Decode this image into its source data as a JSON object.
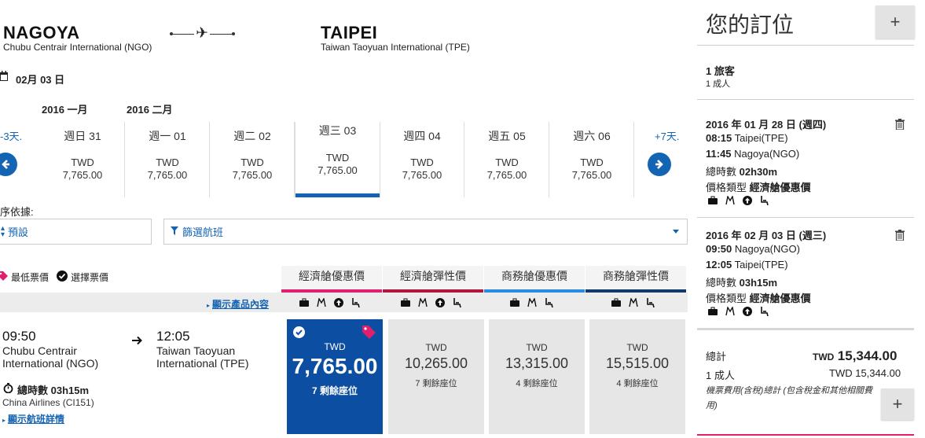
{
  "route": {
    "origin_city": "NAGOYA",
    "origin_airport": "Chubu Centrair International (NGO)",
    "dest_city": "TAIPEI",
    "dest_airport": "Taiwan Taoyuan International (TPE)",
    "plane_glyph": "✈"
  },
  "selected_date": "02月 03 日",
  "months": [
    "2016 一月",
    "2016 二月"
  ],
  "date_strip": {
    "prev_label": "-3天.",
    "next_label": "+7天.",
    "days": [
      {
        "day": "週日 31",
        "currency": "TWD",
        "amount": "7,765.00",
        "active": false
      },
      {
        "day": "週一 01",
        "currency": "TWD",
        "amount": "7,765.00",
        "active": false
      },
      {
        "day": "週二 02",
        "currency": "TWD",
        "amount": "7,765.00",
        "active": false
      },
      {
        "day": "週三 03",
        "currency": "TWD",
        "amount": "7,765.00",
        "active": true
      },
      {
        "day": "週四 04",
        "currency": "TWD",
        "amount": "7,765.00",
        "active": false
      },
      {
        "day": "週五 05",
        "currency": "TWD",
        "amount": "7,765.00",
        "active": false
      },
      {
        "day": "週六 06",
        "currency": "TWD",
        "amount": "7,765.00",
        "active": false
      }
    ]
  },
  "sort": {
    "label": "序依據:",
    "default_value": "預設",
    "filter_value": "篩選航班"
  },
  "legend": {
    "lowest": "最低票價",
    "selected": "選擇票價"
  },
  "show_products": "顯示產品內容",
  "fare_classes": [
    {
      "name": "經濟艙優惠價",
      "color": "#e0206e"
    },
    {
      "name": "經濟艙彈性價",
      "color": "#b0163e"
    },
    {
      "name": "商務艙優惠價",
      "color": "#2a8be0"
    },
    {
      "name": "商務艙彈性價",
      "color": "#103a6e"
    }
  ],
  "flight": {
    "dep_time": "09:50",
    "dep_place_1": "Chubu Centrair",
    "dep_place_2": "International (NGO)",
    "arr_time": "12:05",
    "arr_place_1": "Taiwan Taoyuan",
    "arr_place_2": "International (TPE)",
    "duration": "總時數 03h15m",
    "airline": "China Airlines (CI151)",
    "details_link": "顯示航班詳情",
    "fares": [
      {
        "currency": "TWD",
        "amount": "7,765.00",
        "seats": "7 剩餘座位",
        "selected": true
      },
      {
        "currency": "TWD",
        "amount": "10,265.00",
        "seats": "7 剩餘座位",
        "selected": false
      },
      {
        "currency": "TWD",
        "amount": "13,315.00",
        "seats": "4 剩餘座位",
        "selected": false
      },
      {
        "currency": "TWD",
        "amount": "15,515.00",
        "seats": "4 剩餘座位",
        "selected": false
      }
    ]
  },
  "booking": {
    "title": "您的訂位",
    "plus": "+",
    "travelers_title": "1 旅客",
    "travelers_detail": "1 成人",
    "segments": [
      {
        "date": "2016 年 01 月 28 日 (週四)",
        "dep_time": "08:15",
        "dep_place": "Taipei(TPE)",
        "arr_time": "11:45",
        "arr_place": "Nagoya(NGO)",
        "duration_label": "總時數",
        "duration": "02h30m",
        "fare_type_label": "價格類型",
        "fare_type": "經濟艙優惠價"
      },
      {
        "date": "2016 年 02 月 03 日 (週三)",
        "dep_time": "09:50",
        "dep_place": "Nagoya(NGO)",
        "arr_time": "12:05",
        "arr_place": "Taipei(TPE)",
        "duration_label": "總時數",
        "duration": "03h15m",
        "fare_type_label": "價格類型",
        "fare_type": "經濟艙優惠價"
      }
    ],
    "total_label": "總計",
    "total_currency": "TWD",
    "total_amount": "15,344.00",
    "adult_label": "1 成人",
    "adult_amount": "TWD 15,344.00",
    "note": "機票費用(含稅)總計 (包含稅金和其他相關費用)"
  }
}
